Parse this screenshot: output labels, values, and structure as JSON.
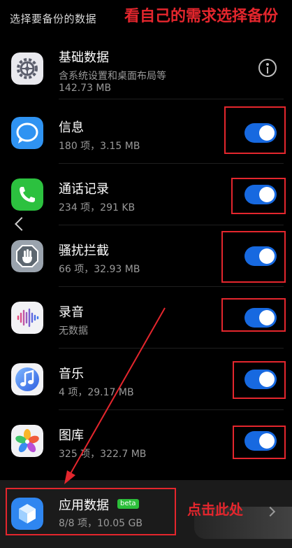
{
  "header": {
    "title": "选择要备份的数据"
  },
  "annotations": {
    "top_note": "看自己的需求选择备份",
    "bottom_note": "点击此处"
  },
  "items": [
    {
      "title": "基础数据",
      "sub": "含系统设置和桌面布局等",
      "sub2": "142.73 MB",
      "icon": "settings-gear-icon"
    },
    {
      "title": "信息",
      "sub": "180 项，3.15 MB",
      "icon": "message-bubble-icon",
      "enabled": true
    },
    {
      "title": "通话记录",
      "sub": "234 项，291 KB",
      "icon": "phone-icon",
      "enabled": true
    },
    {
      "title": "骚扰拦截",
      "sub": "66 项，32.93 MB",
      "icon": "block-hand-icon",
      "enabled": true
    },
    {
      "title": "录音",
      "sub": "无数据",
      "icon": "sound-wave-icon",
      "enabled": true
    },
    {
      "title": "音乐",
      "sub": "4 项，29.17 MB",
      "icon": "music-note-icon",
      "enabled": true
    },
    {
      "title": "图库",
      "sub": "325 项，322.7 MB",
      "icon": "gallery-flower-icon",
      "enabled": true
    }
  ],
  "bottom": {
    "title": "应用数据",
    "badge": "beta",
    "sub": "8/8 项，10.05 GB",
    "icon": "app-cube-icon"
  },
  "colors": {
    "toggle_on": "#1769e0",
    "annotation": "#e4262d",
    "background": "#000000"
  }
}
